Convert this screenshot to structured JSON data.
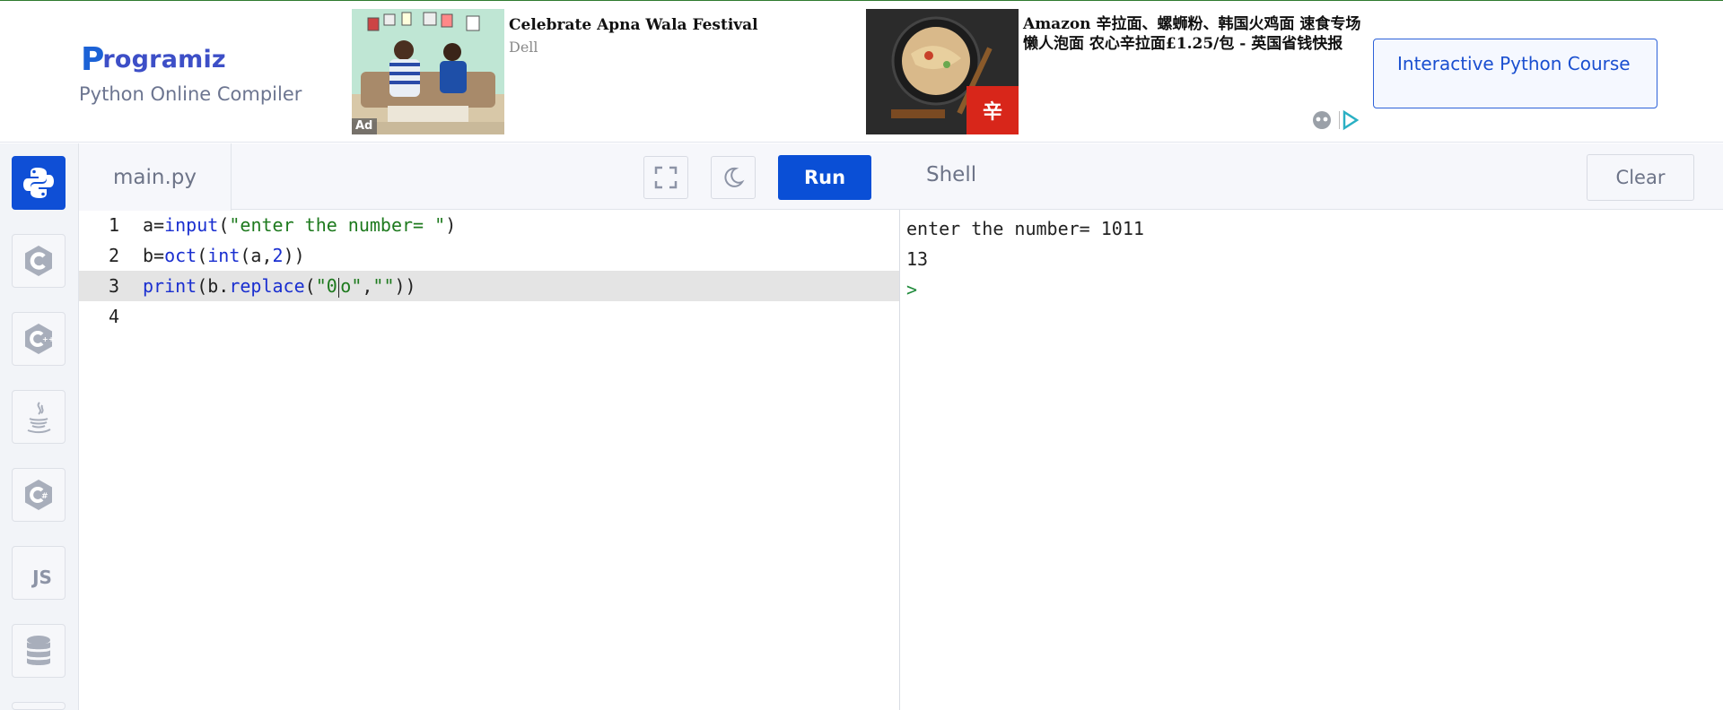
{
  "header": {
    "logo_text": "rogramiz",
    "subtitle": "Python Online Compiler",
    "course_button": "Interactive Python Course"
  },
  "ads": [
    {
      "title": "Celebrate Apna Wala Festival",
      "advertiser": "Dell",
      "badge": "Ad"
    },
    {
      "title": "Amazon 辛拉面、螺蛳粉、韩国火鸡面 速食专场 懒人泡面 农心辛拉面£1.25/包 - 英国省钱快报"
    }
  ],
  "languages": [
    "Python",
    "C",
    "C++",
    "Java",
    "C#",
    "JS",
    "SQL"
  ],
  "editor": {
    "file_tab": "main.py",
    "run_label": "Run",
    "lines": [
      {
        "num": "1",
        "text": "a=input(\"enter the number= \")"
      },
      {
        "num": "2",
        "text": "b=oct(int(a,2))"
      },
      {
        "num": "3",
        "text": "print(b.replace(\"0o\",\"\"))"
      },
      {
        "num": "4",
        "text": ""
      }
    ],
    "highlighted_line": 3
  },
  "shell": {
    "title": "Shell",
    "clear_label": "Clear",
    "output": [
      "enter the number= 1011",
      "13"
    ],
    "prompt": ">"
  },
  "colors": {
    "accent": "#0a4fd6",
    "keyword": "#1a2fd0",
    "string": "#1e7a1e",
    "prompt": "#1e8a3a"
  }
}
